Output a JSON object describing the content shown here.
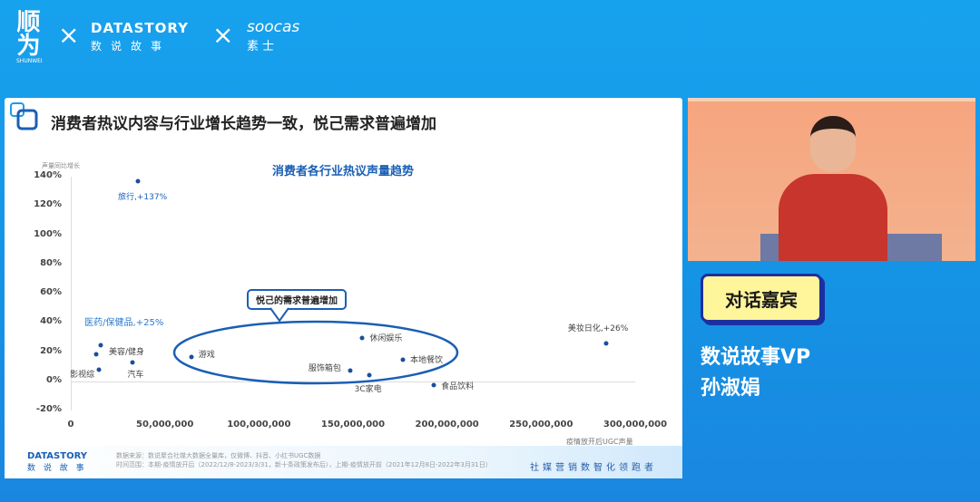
{
  "header": {
    "logo_shunwei": "顺为",
    "logo_shunwei_sub": "SHUNWEI",
    "times": "×",
    "datastory_en": "DATASTORY",
    "datastory_cn": "数说故事",
    "soocas_en": "soocas",
    "soocas_cn": "素士"
  },
  "slide": {
    "title": "消费者热议内容与行业增长趋势一致，悦己需求普遍增加",
    "callout": "悦己的需求普遍增加",
    "footer": {
      "logo_en": "DATASTORY",
      "logo_cn": "数 说 故 事",
      "source": "数据来源：数说聚合社媒大数据全量库，仅微博、抖音、小红书UGC数据",
      "period": "时间范围：本期-疫情放开后（2022/12/8-2023/3/31，新十条政策发布后），上期-疫情放开前（2021年12月8日-2022年3月31日）",
      "slogan": "社媒营销数智化领跑者"
    }
  },
  "chart_data": {
    "type": "scatter",
    "title": "消费者各行业热议声量趋势",
    "xlabel": "疫情放开后UGC声量",
    "ylabel": "声量同比增长",
    "xlim": [
      0,
      300000000
    ],
    "ylim": [
      -20,
      140
    ],
    "xticks": [
      "0",
      "50,000,000",
      "100,000,000",
      "150,000,000",
      "200,000,000",
      "250,000,000",
      "300,000,000"
    ],
    "yticks": [
      "140%",
      "120%",
      "100%",
      "80%",
      "60%",
      "40%",
      "20%",
      "0%",
      "-20%"
    ],
    "points": [
      {
        "label": "旅行,+137%",
        "x": 35700000,
        "y": 137
      },
      {
        "label": "医药/保健品,+25%",
        "x": 16000000,
        "y": 25
      },
      {
        "label": "美容/健身",
        "x": 13500000,
        "y": 18.5
      },
      {
        "label": "影视综",
        "x": 15000000,
        "y": 8
      },
      {
        "label": "汽车",
        "x": 33000000,
        "y": 13
      },
      {
        "label": "游戏",
        "x": 64000000,
        "y": 17
      },
      {
        "label": "休闲娱乐",
        "x": 155000000,
        "y": 30
      },
      {
        "label": "服饰箱包",
        "x": 148500000,
        "y": 7.5
      },
      {
        "label": "3C家电",
        "x": 158500000,
        "y": 4.5
      },
      {
        "label": "本地餐饮",
        "x": 176500000,
        "y": 15
      },
      {
        "label": "食品饮料",
        "x": 193000000,
        "y": -2.5
      },
      {
        "label": "美妆日化,+26%",
        "x": 284500000,
        "y": 26
      }
    ]
  },
  "guest": {
    "badge": "对话嘉宾",
    "role": "数说故事VP",
    "name": "孙淑娟"
  }
}
